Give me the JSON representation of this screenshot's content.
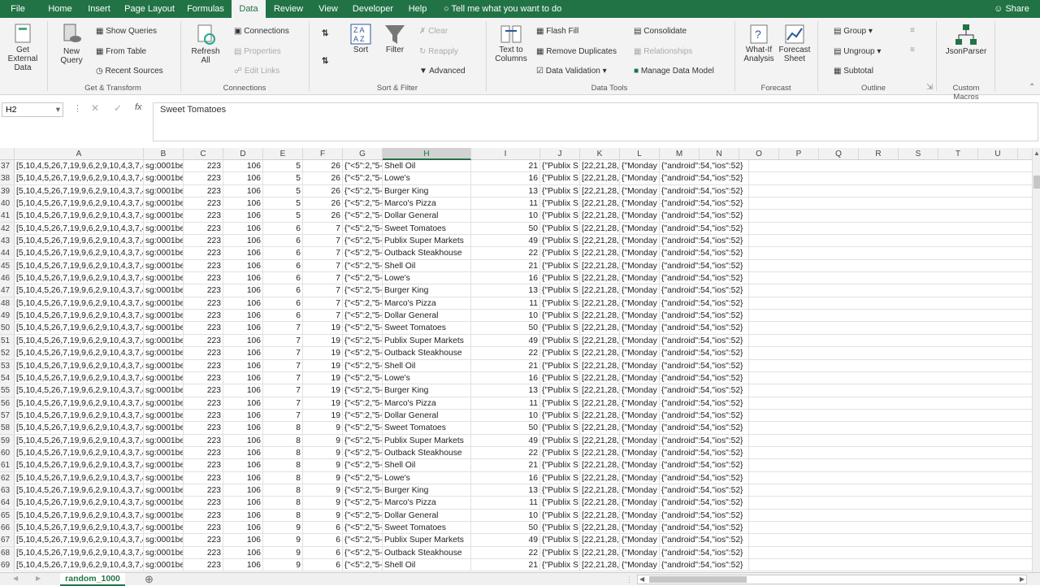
{
  "tabs": [
    "File",
    "Home",
    "Insert",
    "Page Layout",
    "Formulas",
    "Data",
    "Review",
    "View",
    "Developer",
    "Help"
  ],
  "tell_me": "Tell me what you want to do",
  "share": "Share",
  "ribbon": {
    "get_external": "Get External Data",
    "new_query": "New Query",
    "show_queries": "Show Queries",
    "from_table": "From Table",
    "recent_sources": "Recent Sources",
    "get_transform": "Get & Transform",
    "refresh_all": "Refresh All",
    "connections": "Connections",
    "properties": "Properties",
    "edit_links": "Edit Links",
    "connections_group": "Connections",
    "sort": "Sort",
    "filter": "Filter",
    "clear": "Clear",
    "reapply": "Reapply",
    "advanced": "Advanced",
    "sort_filter": "Sort & Filter",
    "text_to_columns": "Text to Columns",
    "flash_fill": "Flash Fill",
    "remove_duplicates": "Remove Duplicates",
    "data_validation": "Data Validation",
    "consolidate": "Consolidate",
    "relationships": "Relationships",
    "manage_data_model": "Manage Data Model",
    "data_tools": "Data Tools",
    "what_if": "What-If Analysis",
    "forecast_sheet": "Forecast Sheet",
    "forecast": "Forecast",
    "group": "Group",
    "ungroup": "Ungroup",
    "subtotal": "Subtotal",
    "outline": "Outline",
    "jsonparser": "JsonParser",
    "custom_macros": "Custom Macros"
  },
  "name_box": "H2",
  "formula": "Sweet Tomatoes",
  "columns": [
    "A",
    "B",
    "C",
    "D",
    "E",
    "F",
    "G",
    "H",
    "I",
    "J",
    "K",
    "L",
    "M",
    "N",
    "O",
    "P",
    "Q",
    "R",
    "S",
    "T",
    "U"
  ],
  "rows": [
    {
      "n": "37",
      "e": "5",
      "f": "26",
      "h": "Shell Oil",
      "i": "21"
    },
    {
      "n": "38",
      "e": "5",
      "f": "26",
      "h": "Lowe's",
      "i": "16"
    },
    {
      "n": "39",
      "e": "5",
      "f": "26",
      "h": "Burger King",
      "i": "13"
    },
    {
      "n": "40",
      "e": "5",
      "f": "26",
      "h": "Marco's Pizza",
      "i": "11"
    },
    {
      "n": "41",
      "e": "5",
      "f": "26",
      "h": "Dollar General",
      "i": "10"
    },
    {
      "n": "42",
      "e": "6",
      "f": "7",
      "h": "Sweet Tomatoes",
      "i": "50"
    },
    {
      "n": "43",
      "e": "6",
      "f": "7",
      "h": "Publix Super Markets",
      "i": "49"
    },
    {
      "n": "44",
      "e": "6",
      "f": "7",
      "h": "Outback Steakhouse",
      "i": "22"
    },
    {
      "n": "45",
      "e": "6",
      "f": "7",
      "h": "Shell Oil",
      "i": "21"
    },
    {
      "n": "46",
      "e": "6",
      "f": "7",
      "h": "Lowe's",
      "i": "16"
    },
    {
      "n": "47",
      "e": "6",
      "f": "7",
      "h": "Burger King",
      "i": "13"
    },
    {
      "n": "48",
      "e": "6",
      "f": "7",
      "h": "Marco's Pizza",
      "i": "11"
    },
    {
      "n": "49",
      "e": "6",
      "f": "7",
      "h": "Dollar General",
      "i": "10"
    },
    {
      "n": "50",
      "e": "7",
      "f": "19",
      "h": "Sweet Tomatoes",
      "i": "50"
    },
    {
      "n": "51",
      "e": "7",
      "f": "19",
      "h": "Publix Super Markets",
      "i": "49"
    },
    {
      "n": "52",
      "e": "7",
      "f": "19",
      "h": "Outback Steakhouse",
      "i": "22"
    },
    {
      "n": "53",
      "e": "7",
      "f": "19",
      "h": "Shell Oil",
      "i": "21"
    },
    {
      "n": "54",
      "e": "7",
      "f": "19",
      "h": "Lowe's",
      "i": "16"
    },
    {
      "n": "55",
      "e": "7",
      "f": "19",
      "h": "Burger King",
      "i": "13"
    },
    {
      "n": "56",
      "e": "7",
      "f": "19",
      "h": "Marco's Pizza",
      "i": "11"
    },
    {
      "n": "57",
      "e": "7",
      "f": "19",
      "h": "Dollar General",
      "i": "10"
    },
    {
      "n": "58",
      "e": "8",
      "f": "9",
      "h": "Sweet Tomatoes",
      "i": "50"
    },
    {
      "n": "59",
      "e": "8",
      "f": "9",
      "h": "Publix Super Markets",
      "i": "49"
    },
    {
      "n": "60",
      "e": "8",
      "f": "9",
      "h": "Outback Steakhouse",
      "i": "22"
    },
    {
      "n": "61",
      "e": "8",
      "f": "9",
      "h": "Shell Oil",
      "i": "21"
    },
    {
      "n": "62",
      "e": "8",
      "f": "9",
      "h": "Lowe's",
      "i": "16"
    },
    {
      "n": "63",
      "e": "8",
      "f": "9",
      "h": "Burger King",
      "i": "13"
    },
    {
      "n": "64",
      "e": "8",
      "f": "9",
      "h": "Marco's Pizza",
      "i": "11"
    },
    {
      "n": "65",
      "e": "8",
      "f": "9",
      "h": "Dollar General",
      "i": "10"
    },
    {
      "n": "66",
      "e": "9",
      "f": "6",
      "h": "Sweet Tomatoes",
      "i": "50"
    },
    {
      "n": "67",
      "e": "9",
      "f": "6",
      "h": "Publix Super Markets",
      "i": "49"
    },
    {
      "n": "68",
      "e": "9",
      "f": "6",
      "h": "Outback Steakhouse",
      "i": "22"
    },
    {
      "n": "69",
      "e": "9",
      "f": "6",
      "h": "Shell Oil",
      "i": "21"
    }
  ],
  "const_a": "[5,10,4,5,26,7,19,9,6,2,9,10,4,3,7,4",
  "const_b": "sg:0001be",
  "const_c": "223",
  "const_d": "106",
  "const_g": "{\"<5\":2,\"5-",
  "const_j": "{\"Publix S",
  "const_k": "[22,21,28,",
  "const_l": "{\"Monday",
  "const_m": "{\"android\":54,\"ios\":52}",
  "sheet_tab": "random_1000",
  "accent": "#217346"
}
